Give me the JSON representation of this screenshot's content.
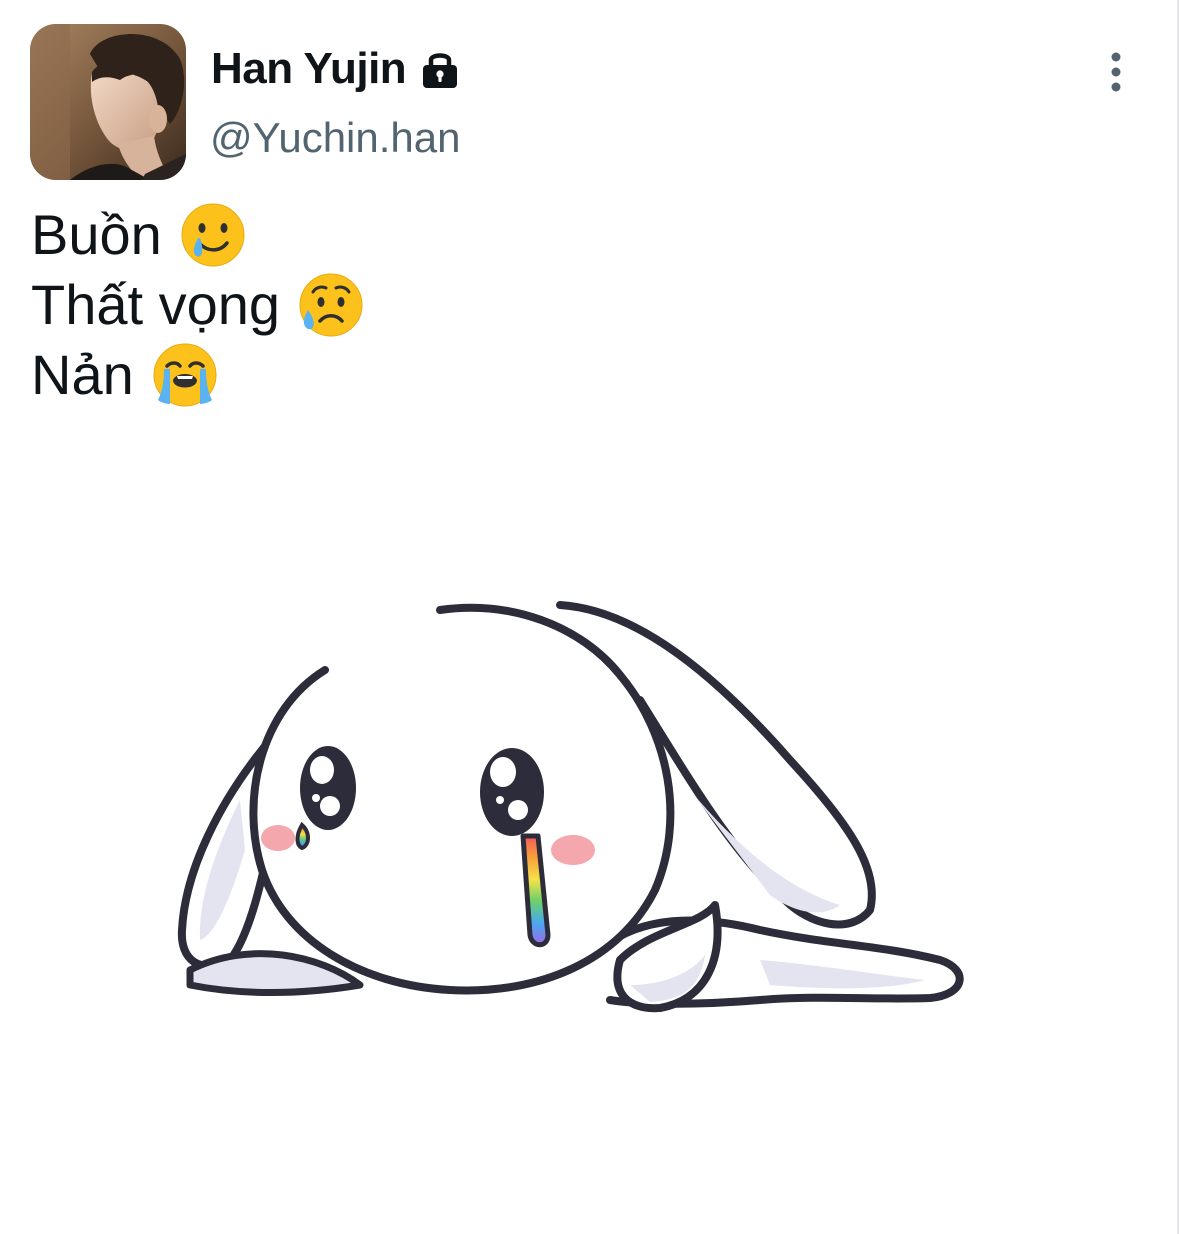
{
  "user": {
    "display_name": "Han Yujin",
    "handle": "@Yuchin.han"
  },
  "tweet": {
    "lines": [
      {
        "text": "Buồn",
        "emoji": "smiling-face-with-tear-emoji"
      },
      {
        "text": "Thất vọng",
        "emoji": "sad-but-relieved-face-emoji"
      },
      {
        "text": "Nản",
        "emoji": "loudly-crying-face-emoji"
      }
    ]
  },
  "icons": {
    "lock": "lock-icon",
    "more": "more-vertical-icon"
  },
  "colors": {
    "name_text": "#0f1419",
    "handle_text": "#536471",
    "body_text": "#0f1419",
    "icon": "#536471"
  }
}
